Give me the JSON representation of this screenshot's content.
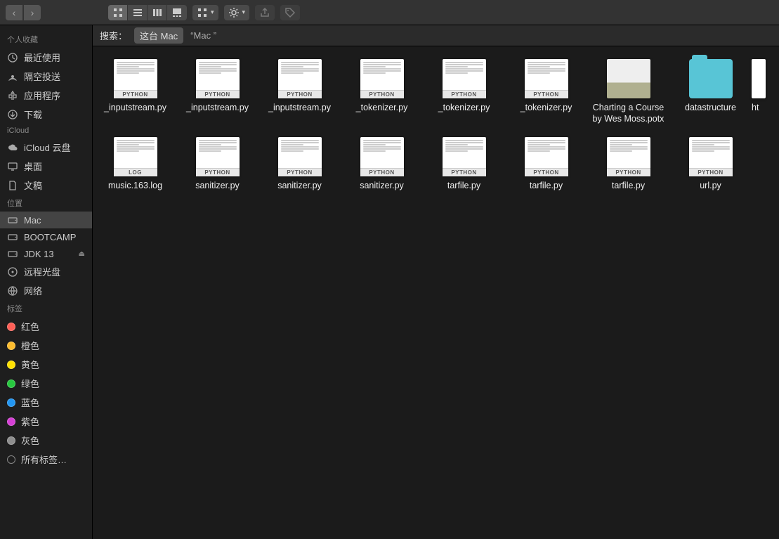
{
  "toolbar": {
    "nav_back_icon": "‹",
    "nav_fwd_icon": "›",
    "view_buttons": [
      "icon-view",
      "list-view",
      "column-view",
      "gallery-view"
    ],
    "active_view": 0,
    "group_icon": "grid",
    "action_icon": "gear",
    "share_icon": "share",
    "tags_icon": "tag"
  },
  "search": {
    "label": "搜索：",
    "scopes": [
      {
        "label": "这台 Mac",
        "active": true
      },
      {
        "label": "“Mac ”",
        "active": false
      }
    ]
  },
  "sidebar": {
    "sections": [
      {
        "title": "个人收藏",
        "items": [
          {
            "icon": "clock",
            "label": "最近使用"
          },
          {
            "icon": "airdrop",
            "label": "隔空投送"
          },
          {
            "icon": "apps",
            "label": "应用程序"
          },
          {
            "icon": "download",
            "label": "下载"
          }
        ]
      },
      {
        "title": "iCloud",
        "items": [
          {
            "icon": "cloud",
            "label": "iCloud 云盘"
          },
          {
            "icon": "desktop",
            "label": "桌面"
          },
          {
            "icon": "doc",
            "label": "文稿"
          }
        ]
      },
      {
        "title": "位置",
        "items": [
          {
            "icon": "disk",
            "label": "Mac",
            "selected": true
          },
          {
            "icon": "disk",
            "label": "BOOTCAMP"
          },
          {
            "icon": "disk",
            "label": "JDK 13",
            "eject": true
          },
          {
            "icon": "cd",
            "label": "远程光盘"
          },
          {
            "icon": "globe",
            "label": "网络"
          }
        ]
      },
      {
        "title": "标签",
        "items": [
          {
            "tag": "#ff5f56",
            "label": "红色"
          },
          {
            "tag": "#ffbd2e",
            "label": "橙色"
          },
          {
            "tag": "#ffe100",
            "label": "黄色"
          },
          {
            "tag": "#27c93f",
            "label": "绿色"
          },
          {
            "tag": "#2196f3",
            "label": "蓝色"
          },
          {
            "tag": "#d63fd6",
            "label": "紫色"
          },
          {
            "tag": "#8e8e8e",
            "label": "灰色"
          },
          {
            "tag": "",
            "label": "所有标签…"
          }
        ]
      }
    ]
  },
  "files": [
    {
      "type": "python",
      "label": "_inputstream.py"
    },
    {
      "type": "python",
      "label": "_inputstream.py"
    },
    {
      "type": "python",
      "label": "_inputstream.py"
    },
    {
      "type": "python",
      "label": "_tokenizer.py"
    },
    {
      "type": "python",
      "label": "_tokenizer.py"
    },
    {
      "type": "python",
      "label": "_tokenizer.py"
    },
    {
      "type": "image",
      "label": "Charting a Course by Wes Moss.potx"
    },
    {
      "type": "folder",
      "label": "datastructure"
    },
    {
      "type": "partial",
      "label": "ht"
    },
    {
      "type": "log",
      "label": "music.163.log"
    },
    {
      "type": "python",
      "label": "sanitizer.py"
    },
    {
      "type": "python",
      "label": "sanitizer.py"
    },
    {
      "type": "python",
      "label": "sanitizer.py"
    },
    {
      "type": "python",
      "label": "tarfile.py"
    },
    {
      "type": "python",
      "label": "tarfile.py"
    },
    {
      "type": "python",
      "label": "tarfile.py"
    },
    {
      "type": "python",
      "label": "url.py"
    }
  ]
}
